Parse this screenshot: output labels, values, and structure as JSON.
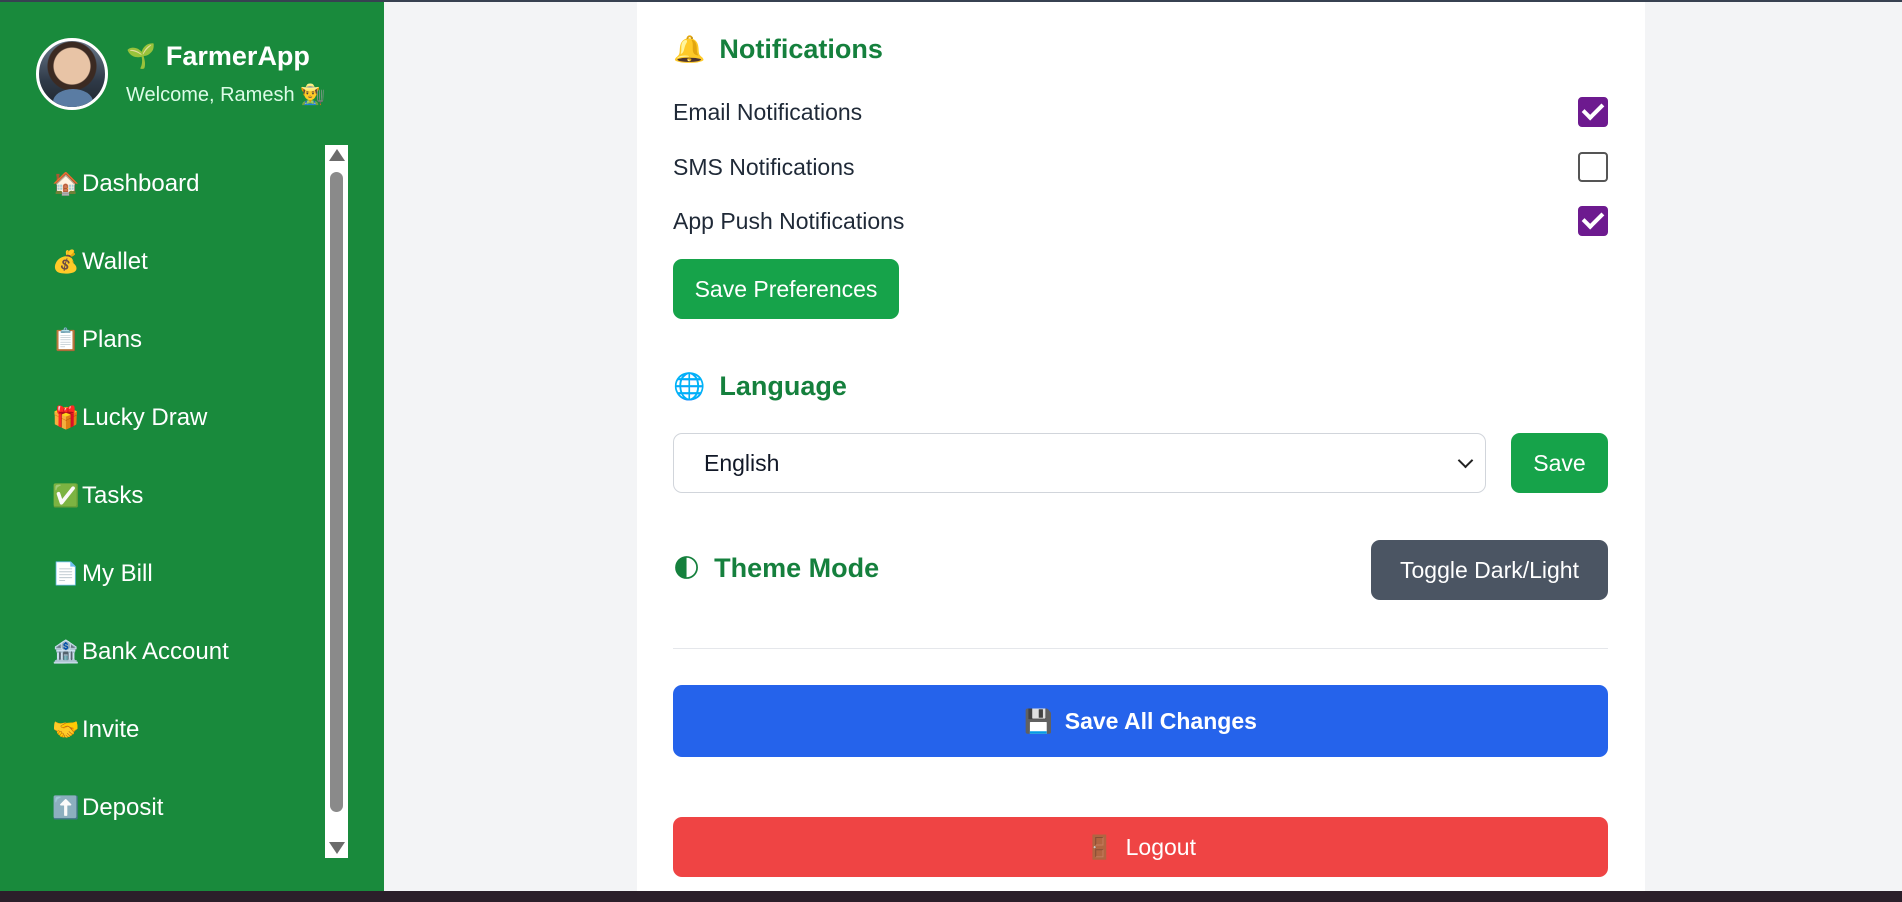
{
  "sidebar": {
    "brand_icon": "🌱",
    "brand": "FarmerApp",
    "welcome": "Welcome, Ramesh 👨‍🌾",
    "items": [
      {
        "icon": "🏠",
        "label": "Dashboard"
      },
      {
        "icon": "💰",
        "label": "Wallet"
      },
      {
        "icon": "📋",
        "label": "Plans"
      },
      {
        "icon": "🎁",
        "label": "Lucky Draw"
      },
      {
        "icon": "✅",
        "label": "Tasks"
      },
      {
        "icon": "📄",
        "label": "My Bill"
      },
      {
        "icon": "🏦",
        "label": "Bank Account"
      },
      {
        "icon": "🤝",
        "label": "Invite"
      },
      {
        "icon": "⬆️",
        "label": "Deposit"
      }
    ]
  },
  "notifications": {
    "icon": "🔔",
    "title": "Notifications",
    "options": [
      {
        "label": "Email Notifications",
        "checked": true
      },
      {
        "label": "SMS Notifications",
        "checked": false
      },
      {
        "label": "App Push Notifications",
        "checked": true
      }
    ],
    "save_label": "Save Preferences"
  },
  "language": {
    "icon": "🌐",
    "title": "Language",
    "selected": "English",
    "save_label": "Save"
  },
  "theme": {
    "icon": "🌓",
    "title": "Theme Mode",
    "toggle_label": "Toggle Dark/Light"
  },
  "actions": {
    "save_all_icon": "💾",
    "save_all_label": "Save All Changes",
    "logout_icon": "🚪",
    "logout_label": "Logout"
  },
  "colors": {
    "sidebar": "#198a3c",
    "accent_green": "#16a34a",
    "title_green": "#15803d",
    "checkbox": "#6d1a8f",
    "blue": "#2563eb",
    "red": "#ef4444",
    "gray": "#4b5563"
  }
}
